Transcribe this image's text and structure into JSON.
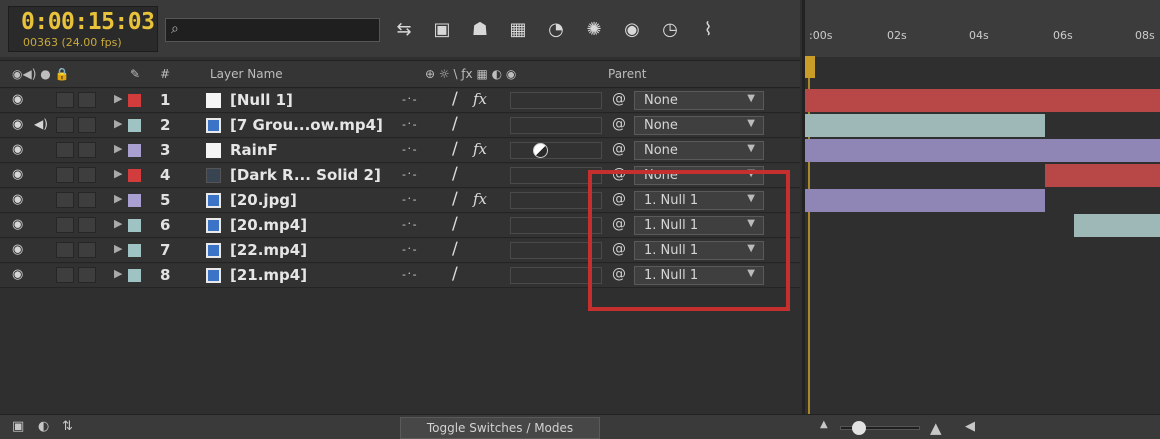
{
  "timecode": {
    "main": "0:00:15:03",
    "sub": "00363 (24.00 fps)"
  },
  "search": {
    "placeholder": ""
  },
  "ruler": {
    "ticks": [
      ":00s",
      "02s",
      "04s",
      "06s",
      "08s"
    ]
  },
  "columns": {
    "layer_name": "Layer Name",
    "parent": "Parent",
    "hash": "#"
  },
  "layers": [
    {
      "num": "1",
      "name": "[Null 1]",
      "label_color": "#d23c3c",
      "icon": "null",
      "fx": true,
      "parent": "None",
      "bar": {
        "from": 0.0,
        "to": 1.0,
        "color": "#b84848"
      }
    },
    {
      "num": "2",
      "name": "[7 Grou...ow.mp4]",
      "label_color": "#9fc3c3",
      "icon": "footage",
      "fx": false,
      "parent": "None",
      "bar": {
        "from": 0.0,
        "to": 0.67,
        "color": "#9db8b6"
      }
    },
    {
      "num": "3",
      "name": "RainF",
      "label_color": "#a99fd1",
      "icon": "null",
      "fx": true,
      "parent": "None",
      "bar": {
        "from": 0.0,
        "to": 1.0,
        "color": "#8f86b5"
      }
    },
    {
      "num": "4",
      "name": "[Dark R... Solid 2]",
      "label_color": "#d23c3c",
      "icon": "solid",
      "fx": false,
      "parent": "None",
      "bar": {
        "from": 0.67,
        "to": 1.0,
        "color": "#b84848"
      }
    },
    {
      "num": "5",
      "name": "[20.jpg]",
      "label_color": "#a99fd1",
      "icon": "footage",
      "fx": true,
      "parent": "1. Null 1",
      "bar": {
        "from": 0.0,
        "to": 0.67,
        "color": "#8f86b5"
      }
    },
    {
      "num": "6",
      "name": "[20.mp4]",
      "label_color": "#9fc3c3",
      "icon": "footage",
      "fx": false,
      "parent": "1. Null 1",
      "bar": {
        "from": 0.75,
        "to": 1.0,
        "color": "#9db8b6"
      }
    },
    {
      "num": "7",
      "name": "[22.mp4]",
      "label_color": "#9fc3c3",
      "icon": "footage",
      "fx": false,
      "parent": "1. Null 1",
      "bar": {
        "from": 0.0,
        "to": 0.0,
        "color": "#9db8b6"
      }
    },
    {
      "num": "8",
      "name": "[21.mp4]",
      "label_color": "#9fc3c3",
      "icon": "footage",
      "fx": false,
      "parent": "1. Null 1",
      "bar": {
        "from": 0.0,
        "to": 0.0,
        "color": "#9db8b6"
      }
    }
  ],
  "bottom": {
    "toggle": "Toggle Switches / Modes"
  },
  "icons": [
    "composition-mini-flowchart-icon",
    "draft-3d-icon",
    "shy-layers-icon",
    "frame-blending-icon",
    "motion-blur-icon",
    "graph-editor-icon"
  ],
  "accent": {
    "timecode": "#e8c23a",
    "cti": "#c99d28",
    "highlight": "#c5302f"
  }
}
